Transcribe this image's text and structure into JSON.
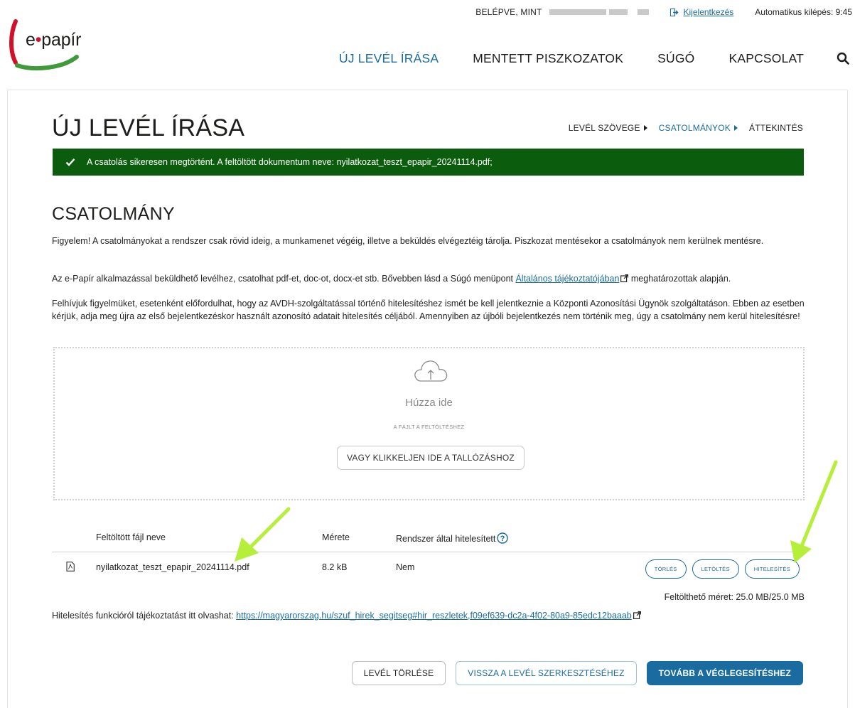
{
  "header": {
    "logo_text_1": "e",
    "logo_text_dot": "•",
    "logo_text_2": "papír",
    "logged_in_label": "BELÉPVE, MINT",
    "logout_label": "Kijelentkezés",
    "auto_logout": "Automatikus kilépés: 9:45"
  },
  "nav": {
    "items": [
      {
        "label": "ÚJ LEVÉL ÍRÁSA",
        "active": true
      },
      {
        "label": "MENTETT PISZKOZATOK"
      },
      {
        "label": "SÚGÓ"
      },
      {
        "label": "KAPCSOLAT"
      }
    ],
    "search_icon": "search-icon"
  },
  "page": {
    "title": "ÚJ LEVÉL ÍRÁSA",
    "steps": [
      {
        "label": "LEVÉL SZÖVEGE"
      },
      {
        "label": "CSATOLMÁNYOK",
        "active": true
      },
      {
        "label": "ÁTTEKINTÉS"
      }
    ]
  },
  "alert": {
    "message": "A csatolás sikeresen megtörtént. A feltöltött dokumentum neve: nyilatkozat_teszt_epapir_20241114.pdf;",
    "color": "#0b5c0d"
  },
  "attachment": {
    "title": "CSATOLMÁNY",
    "p1": "Figyelem! A csatolmányokat a rendszer csak rövid ideig, a munkamenet végéig, illetve a beküldés elvégeztéig tárolja. Piszkozat mentésekor a csatolmányok nem kerülnek mentésre.",
    "p2_before": "Az e-Papír alkalmazással beküldhető levélhez, csatolhat pdf-et, doc-ot, docx-et stb. Bővebben lásd a Súgó menüpont ",
    "p2_link": "Általános tájékoztatójában",
    "p2_after": " meghatározottak alapján.",
    "p3": "Felhívjuk figyelmüket, esetenként előfordulhat, hogy az AVDH-szolgáltatással történő hitelesítéshez ismét be kell jelentkeznie a Központi Azonosítási Ügynök szolgáltatáson. Ebben az esetben kérjük, adja meg újra az első bejelentkezéskor használt azonosító adatait hitelesítés céljából. Amennyiben az újbóli bejelentkezés nem történik meg, úgy a csatolmány nem kerül hitelesítésre!"
  },
  "dropzone": {
    "title": "Húzza ide",
    "subtitle": "A FÁJLT A FELTÖLTÉSHEZ",
    "browse_label": "VAGY KLIKKELJEN IDE A TALLÓZÁSHOZ"
  },
  "table": {
    "headers": {
      "name": "Feltöltött fájl neve",
      "size": "Mérete",
      "verified": "Rendszer által hitelesített"
    },
    "rows": [
      {
        "name": "nyilatkozat_teszt_epapir_20241114.pdf",
        "size": "8.2 kB",
        "verified": "Nem",
        "actions": {
          "delete": "TÖRLÉS",
          "download": "LETÖLTÉS",
          "authenticate": "HITELESÍTÉS"
        }
      }
    ],
    "quota": "Feltölthető méret: 25.0 MB/25.0 MB"
  },
  "auth_info": {
    "text": "Hitelesítés funkcióról tájékoztatást itt olvashat: ",
    "link": "https://magyarorszag.hu/szuf_hirek_segitseg#hir_reszletek,f09ef639-dc2a-4f02-80a9-85edc12baaab"
  },
  "footer_actions": {
    "delete_letter": "LEVÉL TÖRLÉSE",
    "back_to_edit": "VISSZA A LEVÉL SZERKESZTÉSÉHEZ",
    "continue": "TOVÁBB A VÉGLEGESÍTÉSHEZ"
  },
  "colors": {
    "accent": "#1a6ca0",
    "annotation_arrow": "#b5ef3a"
  }
}
